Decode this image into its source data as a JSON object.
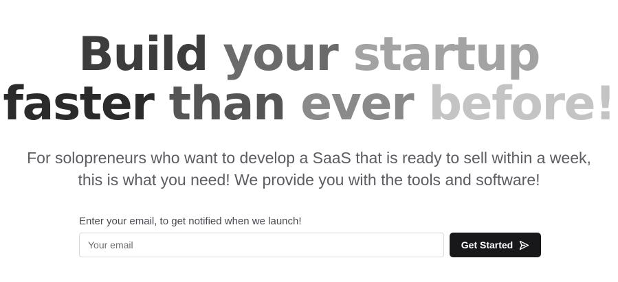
{
  "hero": {
    "headline": {
      "line1": [
        {
          "text": "Build",
          "color": "#3d3d3d"
        },
        {
          "text": "your",
          "color": "#6b6b6b"
        },
        {
          "text": "startup",
          "color": "#a3a3a3"
        }
      ],
      "line2": [
        {
          "text": "faster",
          "color": "#2b2b2b"
        },
        {
          "text": "than",
          "color": "#555555"
        },
        {
          "text": "ever",
          "color": "#8a8a8a"
        },
        {
          "text": "before!",
          "color": "#c4c4c4"
        }
      ]
    },
    "subtitle": "For solopreneurs who want to develop a SaaS that is ready to sell within a week, this is what you need! We provide you with the tools and software!"
  },
  "signup": {
    "label": "Enter your email, to get notified when we launch!",
    "email_placeholder": "Your email",
    "email_value": "",
    "button_label": "Get Started",
    "button_icon": "send-arrow-icon",
    "button_color": "#18181b"
  }
}
